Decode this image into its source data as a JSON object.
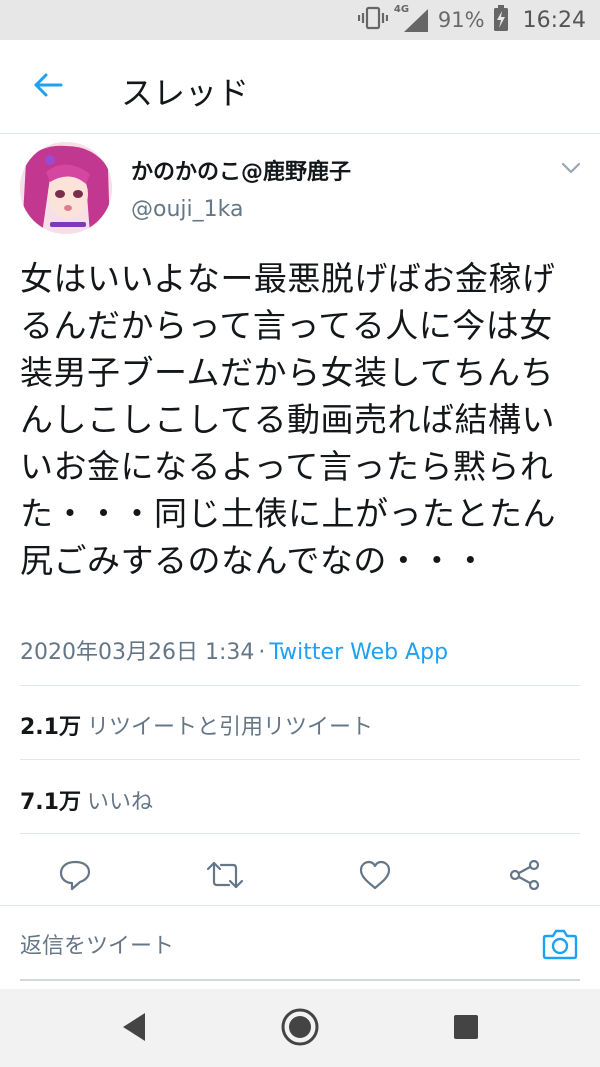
{
  "status_bar": {
    "network": "4G",
    "battery": "91%",
    "time": "16:24"
  },
  "header": {
    "title": "スレッド",
    "back_icon": "back-arrow-icon"
  },
  "tweet": {
    "display_name": "かのかのこ@鹿野鹿子",
    "handle": "@ouji_1ka",
    "text": "女はいいよなー最悪脱げばお金稼げるんだからって言ってる人に今は女装男子ブームだから女装してちんちんしこしこしてる動画売れば結構いいお金になるよって言ったら黙られた・・・同じ土俵に上がったとたん尻ごみするのなんでなの・・・",
    "date": "2020年03月26日 1:34",
    "separator": "·",
    "source": "Twitter Web App"
  },
  "stats": {
    "retweets_count": "2.1万",
    "retweets_label": "リツイートと引用リツイート",
    "likes_count": "7.1万",
    "likes_label": "いいね"
  },
  "actions": [
    "reply-icon",
    "retweet-icon",
    "like-icon",
    "share-icon"
  ],
  "reply": {
    "placeholder": "返信をツイート",
    "camera_icon": "camera-icon"
  },
  "colors": {
    "accent": "#1da1f2",
    "text": "#14171a",
    "muted": "#657786",
    "divider": "#e1e8ed"
  }
}
